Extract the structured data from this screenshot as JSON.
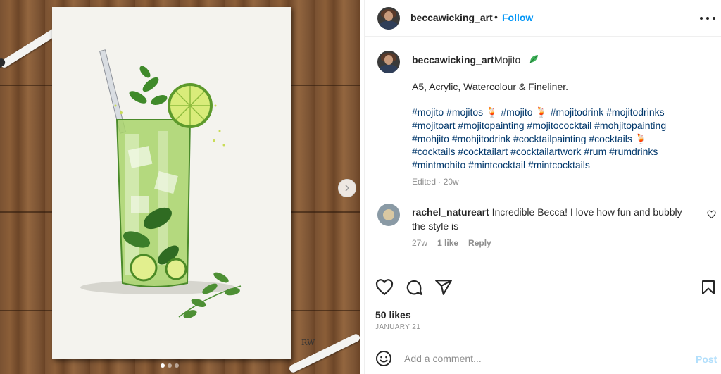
{
  "post": {
    "username": "beccawicking_art",
    "follow_label": "Follow",
    "bullet": "•"
  },
  "caption": {
    "username": "beccawicking_art",
    "title": "Mojito",
    "title_emoji": "leaf-emoji",
    "description": "A5, Acrylic, Watercolour & Fineliner.",
    "hashtag_lines": [
      [
        "#mojito",
        "#mojitos",
        "🍹",
        "#mojito",
        "🍹",
        "#mojitodrink",
        "#mojitodrinks"
      ],
      [
        "#mojitoart",
        "#mojitopainting",
        "#mojitococktail",
        "#mohjitopainting"
      ],
      [
        "#mohjito",
        "#mohjitodrink",
        "#cocktailpainting",
        "#cocktails",
        "🍹"
      ],
      [
        "#cocktails",
        "#cocktailart",
        "#cocktailartwork",
        "#rum",
        "#rumdrinks"
      ],
      [
        "#mintmohito",
        "#mintcocktail",
        "#mintcocktails"
      ]
    ],
    "meta": "Edited · 20w"
  },
  "comment": {
    "username": "rachel_natureart",
    "text": "Incredible Becca! I love how fun and bubbly the style is",
    "age": "27w",
    "likes": "1 like",
    "reply_label": "Reply"
  },
  "actions": {
    "likes": "50 likes",
    "date": "JANUARY 21",
    "icons": [
      "heart-icon",
      "comment-icon",
      "share-icon",
      "bookmark-icon"
    ]
  },
  "add_comment": {
    "placeholder": "Add a comment...",
    "post_label": "Post"
  },
  "media": {
    "signature": "RW",
    "carousel_index": 1,
    "carousel_count": 3
  },
  "colors": {
    "link_blue": "#0095f6",
    "hashtag_blue": "#00376b",
    "muted_gray": "#8e8e8e",
    "post_disabled": "#b2dffc"
  }
}
